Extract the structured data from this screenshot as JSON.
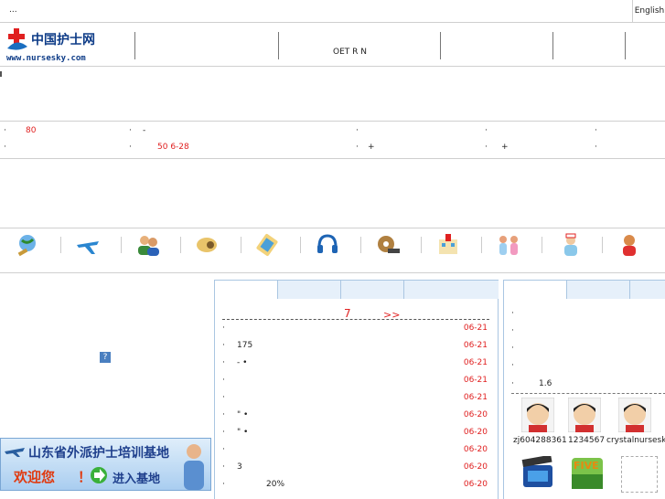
{
  "topbar": {
    "dots": "...",
    "english": "English"
  },
  "header": {
    "logo_name": "中国护士网",
    "logo_url": "www.nursesky.com",
    "nav_text": "OET R N"
  },
  "links": {
    "r1": [
      "·",
      "80",
      "·",
      "-",
      "·",
      "·",
      "·"
    ],
    "r2": [
      "·",
      "·",
      "50 6-28",
      "·",
      "+",
      "·",
      "+",
      "·"
    ]
  },
  "icons": [
    "globe-icon",
    "airplane-icon",
    "users-icon",
    "stethoscope-icon",
    "tablet-icon",
    "headset-icon",
    "film-icon",
    "hospital-icon",
    "nurses-group-icon",
    "nurse-icon",
    "operator-icon"
  ],
  "left_panel": {
    "help_icon": "?",
    "banner": {
      "line1": "山东省外派护士培训基地",
      "line2_a": "欢迎您",
      "line2_b": "！",
      "line2_c": "进入基地"
    }
  },
  "news": {
    "header_a": "7",
    "header_b": ">>",
    "items": [
      {
        "bullet": "·",
        "text": "",
        "date": "06-21"
      },
      {
        "bullet": "·",
        "text": "175",
        "date": "06-21"
      },
      {
        "bullet": "·",
        "text": "- •",
        "date": "06-21"
      },
      {
        "bullet": "·",
        "text": "",
        "date": "06-21"
      },
      {
        "bullet": "·",
        "text": "",
        "date": "06-21"
      },
      {
        "bullet": "·",
        "text": "\" •",
        "date": "06-20"
      },
      {
        "bullet": "·",
        "text": "\" •",
        "date": "06-20"
      },
      {
        "bullet": "·",
        "text": "",
        "date": "06-20"
      },
      {
        "bullet": "·",
        "text": "3",
        "date": "06-20"
      },
      {
        "bullet": "·",
        "text": "20%",
        "date": "06-20"
      }
    ]
  },
  "right_panel": {
    "items": [
      "·",
      "·",
      "·",
      "·",
      "1.6"
    ],
    "users": [
      "zj604288361",
      "1234567",
      "crystalnursesky"
    ],
    "bottom_icons": [
      "clapper-icon",
      "five-icon",
      "empty-placeholder"
    ],
    "five_label": "FIVE"
  }
}
